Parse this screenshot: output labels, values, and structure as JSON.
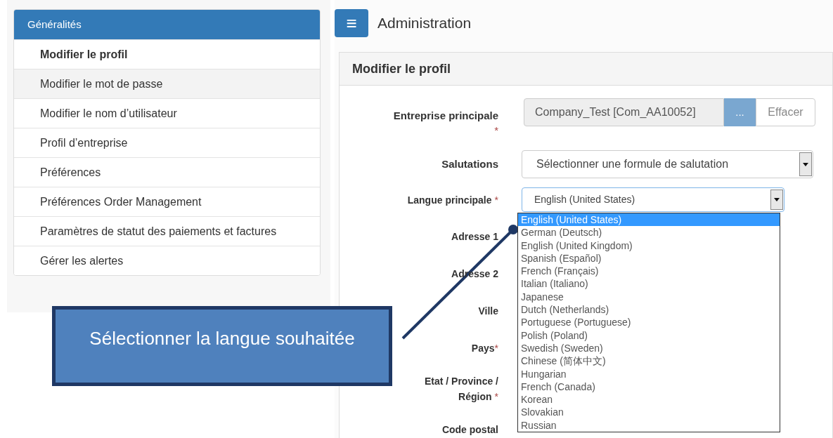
{
  "sidebar": {
    "title": "Généralités",
    "items": [
      {
        "label": "Modifier le profil",
        "selected": true,
        "hovered": false
      },
      {
        "label": "Modifier le mot de passe",
        "selected": false,
        "hovered": true
      },
      {
        "label": "Modifier le nom d’utilisateur",
        "selected": false,
        "hovered": false
      },
      {
        "label": "Profil d’entreprise",
        "selected": false,
        "hovered": false
      },
      {
        "label": "Préférences",
        "selected": false,
        "hovered": false
      },
      {
        "label": "Préférences Order Management",
        "selected": false,
        "hovered": false
      },
      {
        "label": "Paramètres de statut des paiements et factures",
        "selected": false,
        "hovered": false
      },
      {
        "label": "Gérer les alertes",
        "selected": false,
        "hovered": false
      }
    ]
  },
  "header": {
    "menu_icon": "≡",
    "title": "Administration"
  },
  "panel": {
    "title": "Modifier le profil",
    "fields": [
      {
        "kind": "picker",
        "label": "Entreprise principale",
        "required_mark": "*",
        "value": "Company_Test [Com_AA10052]",
        "browse": "...",
        "clear": "Effacer"
      },
      {
        "kind": "select",
        "label": "Salutations",
        "value": "Sélectionner une formule de salutation",
        "expanded": false
      },
      {
        "kind": "select",
        "label": "Langue principale",
        "required_mark": "*",
        "value": "English (United States)",
        "expanded": true,
        "options": [
          {
            "label": "English (United States)",
            "selected": true
          },
          {
            "label": "German (Deutsch)",
            "selected": false
          },
          {
            "label": "English (United Kingdom)",
            "selected": false
          },
          {
            "label": "Spanish (Español)",
            "selected": false
          },
          {
            "label": "French (Français)",
            "selected": false
          },
          {
            "label": "Italian (Italiano)",
            "selected": false
          },
          {
            "label": "Japanese",
            "selected": false
          },
          {
            "label": "Dutch (Netherlands)",
            "selected": false
          },
          {
            "label": "Portuguese (Portuguese)",
            "selected": false
          },
          {
            "label": "Polish (Poland)",
            "selected": false
          },
          {
            "label": "Swedish (Sweden)",
            "selected": false
          },
          {
            "label": "Chinese (简体中文)",
            "selected": false
          },
          {
            "label": "Hungarian",
            "selected": false
          },
          {
            "label": "French (Canada)",
            "selected": false
          },
          {
            "label": "Korean",
            "selected": false
          },
          {
            "label": "Slovakian",
            "selected": false
          },
          {
            "label": "Russian",
            "selected": false
          }
        ]
      },
      {
        "kind": "label",
        "label": "Adresse 1"
      },
      {
        "kind": "label",
        "label": "Adresse 2"
      },
      {
        "kind": "label",
        "label": "Ville"
      },
      {
        "kind": "label",
        "label": "Pays",
        "required_mark": "*"
      },
      {
        "kind": "label",
        "label": "Etat / Province / Région",
        "required_mark": "*"
      },
      {
        "kind": "label",
        "label": "Code postal"
      }
    ]
  },
  "callout": {
    "text": "Sélectionner la langue souhaitée"
  }
}
